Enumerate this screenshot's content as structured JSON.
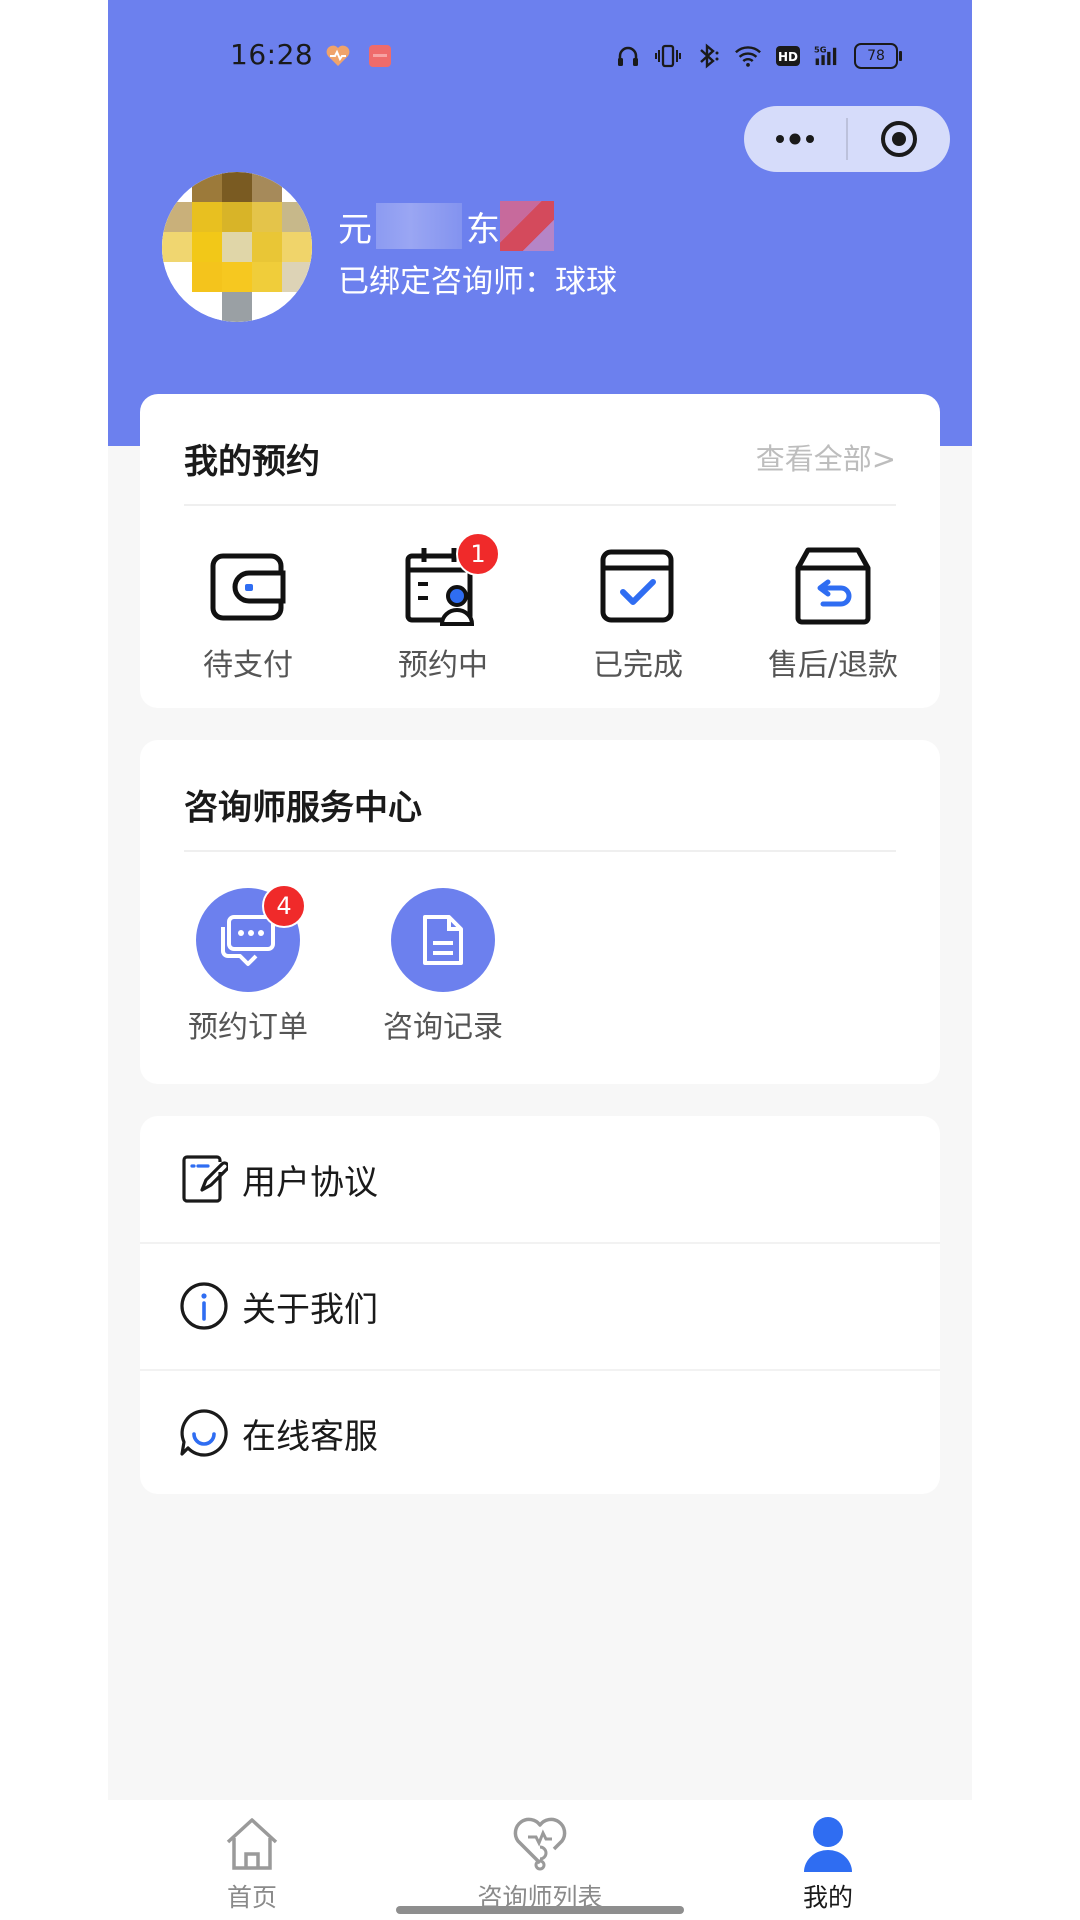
{
  "status_bar": {
    "time": "16:28",
    "battery": "78",
    "network": "5G",
    "hd": "HD",
    "icons": [
      "heart-pulse-icon",
      "app-notification-icon",
      "headphones-icon",
      "vibrate-icon",
      "bluetooth-icon",
      "wifi-icon",
      "hd-icon",
      "signal-5g-icon",
      "battery-icon"
    ]
  },
  "capsule": {
    "icons": [
      "more-dots-icon",
      "close-target-icon"
    ]
  },
  "profile": {
    "nickname_start": "元",
    "nickname_end": "东",
    "bound_label": "已绑定咨询师：",
    "consultant_name": "球球"
  },
  "appointments": {
    "title": "我的预约",
    "view_all": "查看全部>",
    "items": [
      {
        "label": "待支付",
        "icon": "wallet-icon",
        "badge": ""
      },
      {
        "label": "预约中",
        "icon": "calendar-person-icon",
        "badge": "1"
      },
      {
        "label": "已完成",
        "icon": "check-calendar-icon",
        "badge": ""
      },
      {
        "label": "售后/退款",
        "icon": "refund-box-icon",
        "badge": ""
      }
    ]
  },
  "service_center": {
    "title": "咨询师服务中心",
    "items": [
      {
        "label": "预约订单",
        "icon": "chat-bubble-icon",
        "badge": "4"
      },
      {
        "label": "咨询记录",
        "icon": "document-icon",
        "badge": ""
      }
    ]
  },
  "menu": {
    "items": [
      {
        "label": "用户协议",
        "icon": "edit-document-icon"
      },
      {
        "label": "关于我们",
        "icon": "info-icon"
      },
      {
        "label": "在线客服",
        "icon": "customer-service-icon"
      }
    ]
  },
  "tabbar": {
    "items": [
      {
        "label": "首页",
        "icon": "home-icon",
        "active": false
      },
      {
        "label": "咨询师列表",
        "icon": "heart-stethoscope-icon",
        "active": false
      },
      {
        "label": "我的",
        "icon": "user-icon",
        "active": true
      }
    ]
  },
  "colors": {
    "primary": "#6c80ee",
    "badge": "#f02a2a",
    "background": "#f7f7f7",
    "accent_blue": "#2f6df2"
  }
}
